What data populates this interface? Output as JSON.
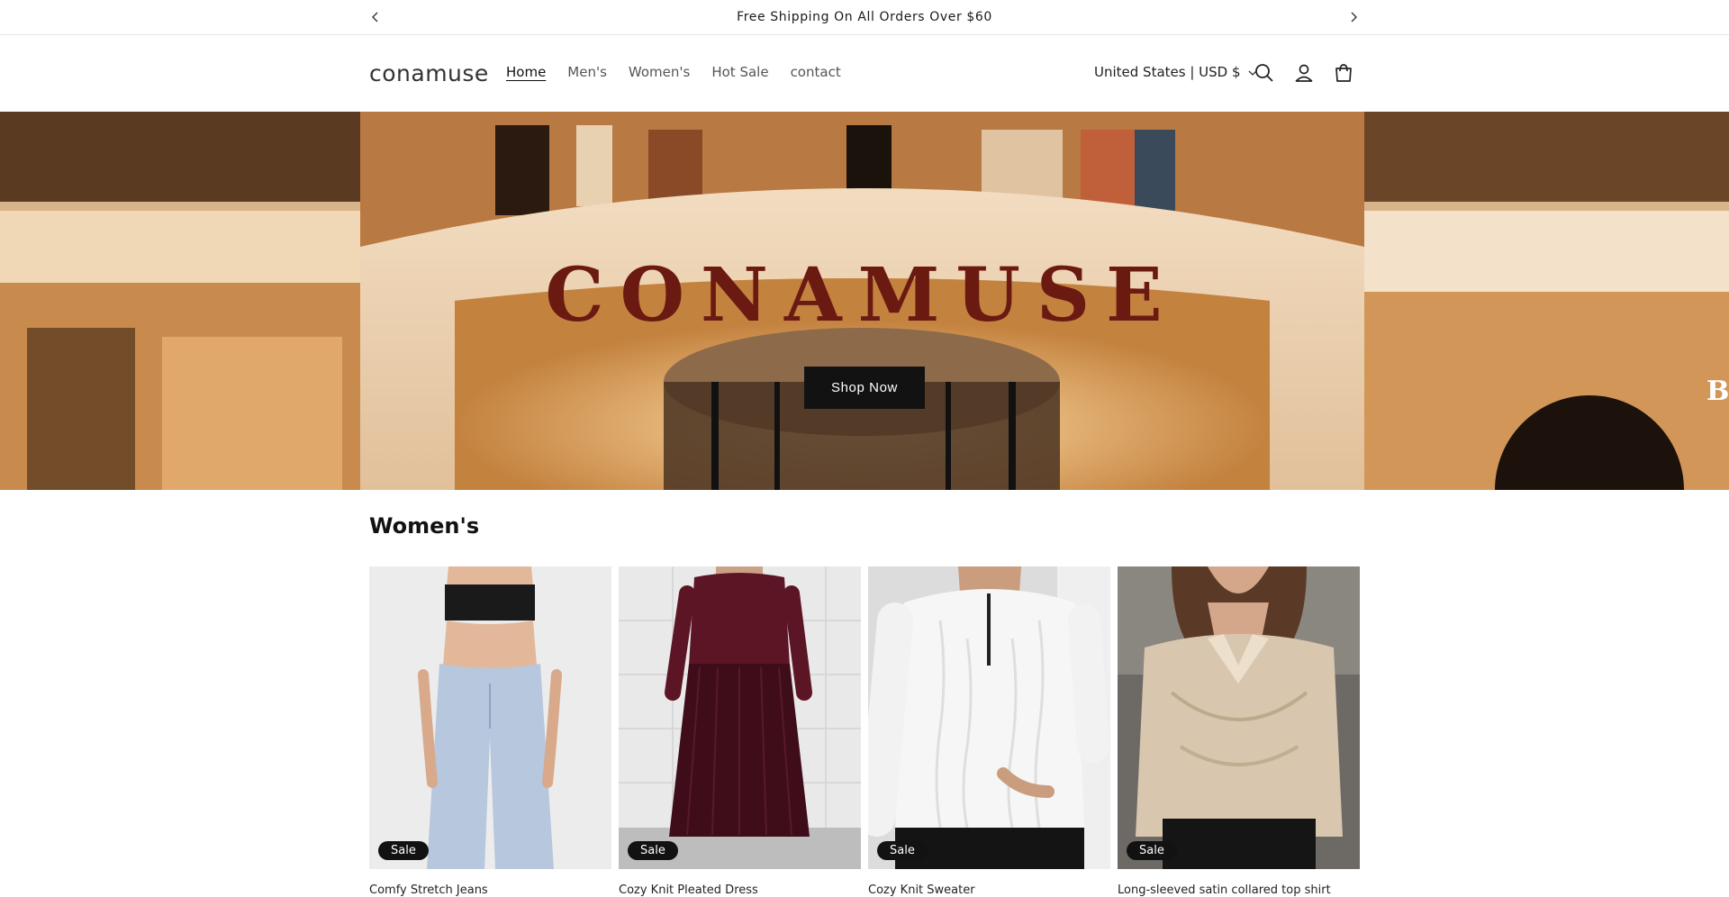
{
  "announcement": {
    "text": "Free Shipping On All Orders Over $60",
    "prev_icon": "chevron-left-icon",
    "next_icon": "chevron-right-icon"
  },
  "header": {
    "logo": "conamuse",
    "nav": [
      {
        "label": "Home",
        "active": true
      },
      {
        "label": "Men's",
        "active": false
      },
      {
        "label": "Women's",
        "active": false
      },
      {
        "label": "Hot Sale",
        "active": false
      },
      {
        "label": "contact",
        "active": false
      }
    ],
    "locale": "United States | USD $",
    "icons": [
      "search-icon",
      "account-icon",
      "cart-icon"
    ]
  },
  "hero": {
    "sign_text": "CONAMUSE",
    "side_letter": "B",
    "button_label": "Shop Now"
  },
  "collection": {
    "title": "Women's",
    "products": [
      {
        "title": "Comfy Stretch Jeans",
        "badge": "Sale"
      },
      {
        "title": "Cozy Knit Pleated Dress",
        "badge": "Sale"
      },
      {
        "title": "Cozy Knit Sweater",
        "badge": "Sale"
      },
      {
        "title": "Long-sleeved satin collared top shirt",
        "badge": "Sale"
      }
    ]
  },
  "colors": {
    "text": "#121212",
    "button_bg": "#121212",
    "hero_warm": "#c9894a",
    "sign_letters": "#6b1a12"
  }
}
